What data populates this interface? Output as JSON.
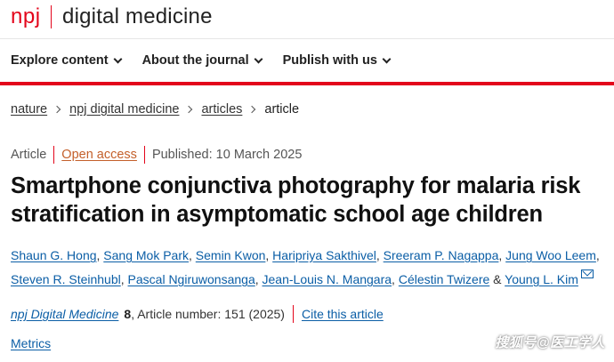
{
  "header": {
    "logo_brand": "npj",
    "logo_journal": "digital medicine"
  },
  "nav": {
    "items": [
      {
        "label": "Explore content"
      },
      {
        "label": "About the journal"
      },
      {
        "label": "Publish with us"
      }
    ]
  },
  "breadcrumb": {
    "items": [
      "nature",
      "npj digital medicine",
      "articles"
    ],
    "current": "article"
  },
  "article": {
    "type": "Article",
    "access": "Open access",
    "published": "Published: 10 March 2025",
    "title": "Smartphone conjunctiva photography for malaria risk stratification in asymptomatic school age children",
    "authors": [
      "Shaun G. Hong",
      "Sang Mok Park",
      "Semin Kwon",
      "Haripriya Sakthivel",
      "Sreeram P. Nagappa",
      "Jung Woo Leem",
      "Steven R. Steinhubl",
      "Pascal Ngiruwonsanga",
      "Jean-Louis N. Mangara",
      "Célestin Twizere",
      "Young L. Kim"
    ],
    "author_separator": ",",
    "author_last_joiner": "&",
    "citation": {
      "journal": "npj Digital Medicine",
      "volume": "8",
      "details": ", Article number: 151 (2025)",
      "cite_label": "Cite this article"
    },
    "metrics_label": "Metrics"
  },
  "watermark": "搜狐号@医工学人",
  "colors": {
    "brand_red": "#e3051b",
    "link_blue": "#0b5ea6",
    "open_access_orange": "#c4602b"
  }
}
